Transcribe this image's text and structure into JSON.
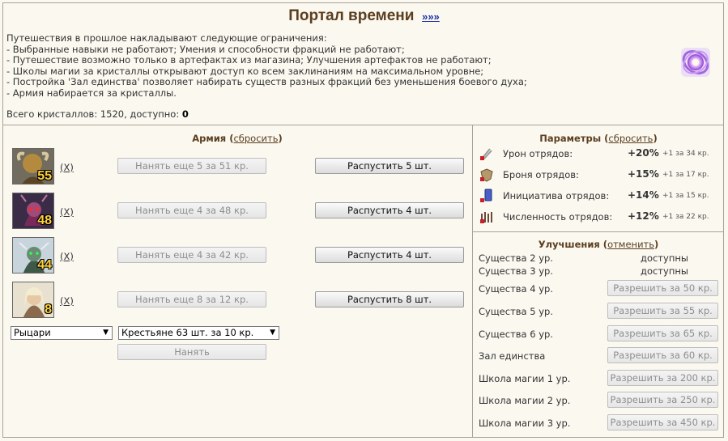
{
  "header": {
    "title": "Портал времени",
    "link": "»»»",
    "intro_lines": [
      "Путешествия в прошлое накладывают следующие ограничения:",
      "- Выбранные навыки не работают; Умения и способности фракций не работают;",
      "- Путешествие возможно только в артефактах из магазина; Улучшения артефактов не работают;",
      "- Школы магии за кристаллы открывают доступ ко всем заклинаниям на максимальном уровне;",
      "- Постройка 'Зал единства' позволяет набирать существ разных фракций без уменьшения боевого духа;",
      "- Армия набирается за кристаллы."
    ],
    "crystals_text": "Всего кристаллов: 1520, доступно: ",
    "crystals_available": "0"
  },
  "army": {
    "title": "Армия",
    "reset_label": "сбросить",
    "units": [
      {
        "count": "55",
        "remove": "(X)",
        "hire": "Нанять еще 5 за 51 кр.",
        "dismiss": "Распустить 5 шт."
      },
      {
        "count": "48",
        "remove": "(X)",
        "hire": "Нанять еще 4 за 48 кр.",
        "dismiss": "Распустить 4 шт."
      },
      {
        "count": "44",
        "remove": "(X)",
        "hire": "Нанять еще 4 за 42 кр.",
        "dismiss": "Распустить 4 шт."
      },
      {
        "count": "8",
        "remove": "(X)",
        "hire": "Нанять еще 8 за 12 кр.",
        "dismiss": "Распустить 8 шт."
      }
    ],
    "faction_select": "Рыцари",
    "creature_select": "Крестьяне 63 шт. за 10 кр.",
    "hire_button": "Нанять"
  },
  "params": {
    "title": "Параметры",
    "reset_label": "сбросить",
    "rows": [
      {
        "icon": "sword-damage-icon",
        "label": "Урон отрядов:",
        "value": "+20%",
        "cost": "+1 за 34 кр."
      },
      {
        "icon": "shield-armor-icon",
        "label": "Броня отрядов:",
        "value": "+15%",
        "cost": "+1 за 17 кр."
      },
      {
        "icon": "hourglass-initiative-icon",
        "label": "Инициатива отрядов:",
        "value": "+14%",
        "cost": "+1 за 15 кр."
      },
      {
        "icon": "troops-count-icon",
        "label": "Численность отрядов:",
        "value": "+12%",
        "cost": "+1 за 22 кр."
      }
    ]
  },
  "upgrades": {
    "title": "Улучшения",
    "cancel_label": "отменить",
    "rows": [
      {
        "label": "Существа 2 ур.",
        "status": "доступны"
      },
      {
        "label": "Существа 3 ур.",
        "status": "доступны"
      },
      {
        "label": "Существа 4 ур.",
        "button": "Разрешить за 50 кр."
      },
      {
        "label": "Существа 5 ур.",
        "button": "Разрешить за 55 кр."
      },
      {
        "label": "Существа 6 ур.",
        "button": "Разрешить за 65 кр."
      },
      {
        "label": "Зал единства",
        "button": "Разрешить за 60 кр."
      },
      {
        "label": "Школа магии 1 ур.",
        "button": "Разрешить за 200 кр."
      },
      {
        "label": "Школа магии 2 ур.",
        "button": "Разрешить за 250 кр."
      },
      {
        "label": "Школа магии 3 ур.",
        "button": "Разрешить за 450 кр."
      }
    ]
  }
}
